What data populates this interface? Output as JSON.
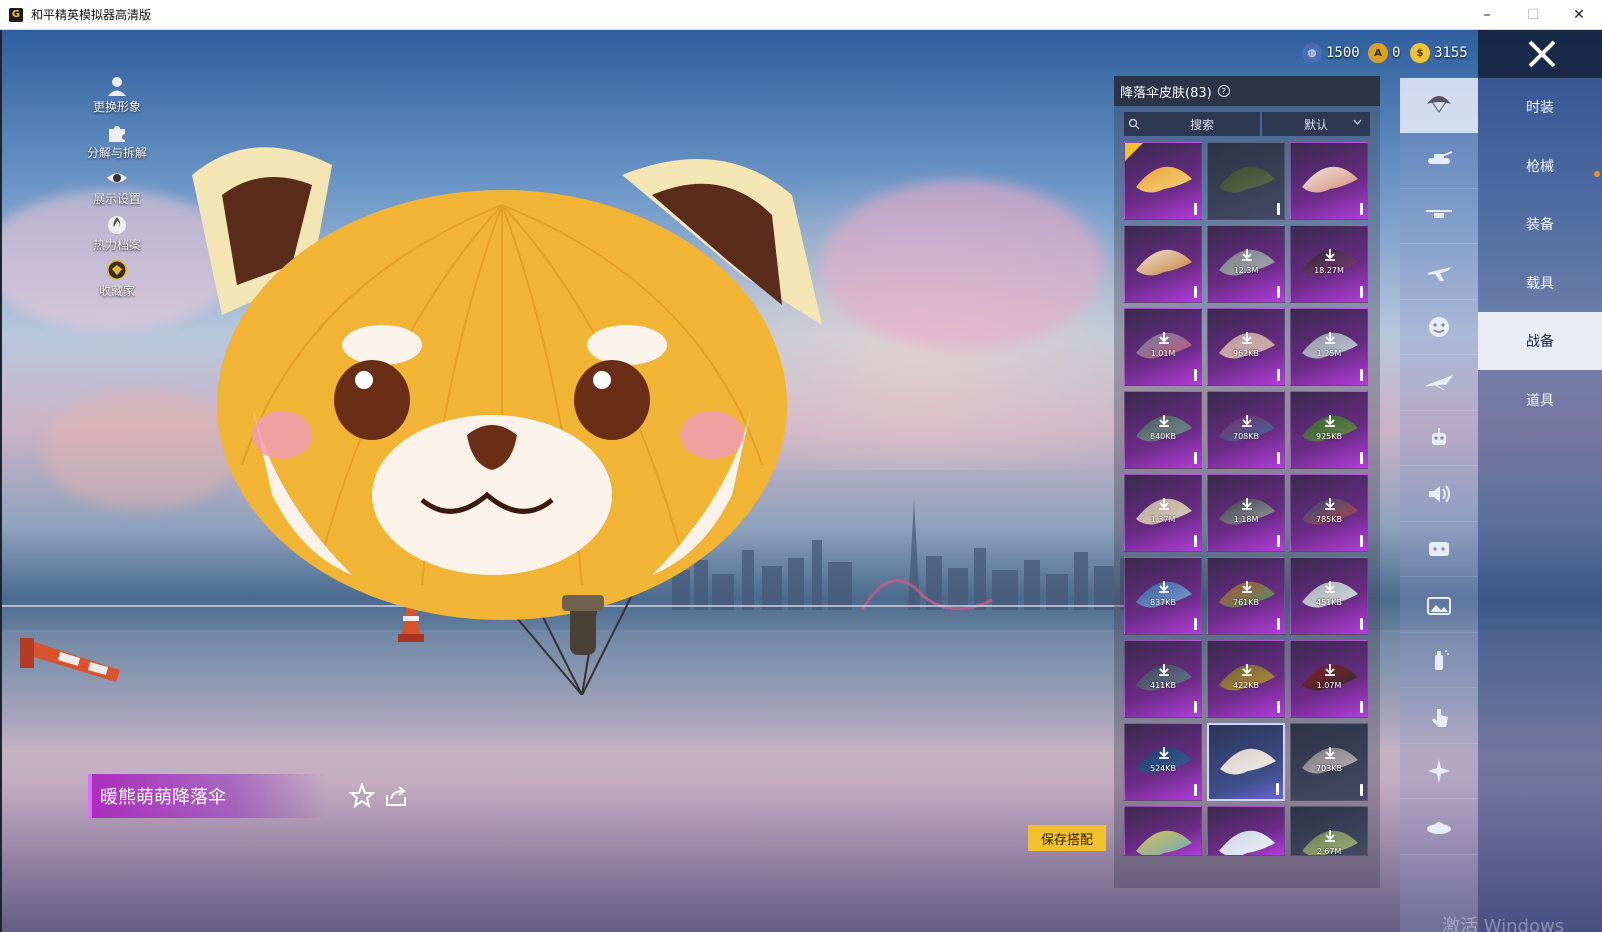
{
  "window": {
    "title": "和平精英模拟器高清版",
    "app_icon_letter": "G",
    "controls": {
      "minimize": "–",
      "maximize": "☐",
      "close": "✕"
    }
  },
  "quick_menu": [
    {
      "label": "更换形象",
      "icon": "person-icon"
    },
    {
      "label": "分解与拆解",
      "icon": "puzzle-icon"
    },
    {
      "label": "展示设置",
      "icon": "eye-icon"
    },
    {
      "label": "热力档案",
      "icon": "flame-icon"
    },
    {
      "label": "收藏家",
      "icon": "collector-badge-icon"
    }
  ],
  "currency": [
    {
      "icon": "globe-coin-icon",
      "amount": "1500",
      "color": "#4a6fb8"
    },
    {
      "icon": "a-coin-icon",
      "amount": "0",
      "color": "#d8a12c"
    },
    {
      "icon": "gold-coin-icon",
      "amount": "3155",
      "color": "#f0c23a"
    }
  ],
  "item_name": "暖熊萌萌降落伞",
  "save_button": "保存搭配",
  "panel": {
    "title": "降落伞皮肤(83)",
    "search_placeholder": "搜索",
    "sort_label": "默认"
  },
  "skins": [
    {
      "style": "purple",
      "size": "",
      "selected": false,
      "tag": true,
      "colors": [
        "#e9a33a",
        "#f5d27c"
      ]
    },
    {
      "style": "dark",
      "size": "",
      "selected": false,
      "tag": false,
      "colors": [
        "#3e4a34",
        "#5b6a49"
      ]
    },
    {
      "style": "purple",
      "size": "",
      "selected": false,
      "tag": false,
      "colors": [
        "#f1e7e0",
        "#d28b74"
      ]
    },
    {
      "style": "purple",
      "size": "",
      "selected": false,
      "tag": false,
      "colors": [
        "#efe1d2",
        "#c6813e"
      ]
    },
    {
      "style": "purple",
      "size": "12.3M",
      "selected": false,
      "tag": false,
      "colors": [
        "#7a7d86",
        "#a6a9b0"
      ]
    },
    {
      "style": "purple",
      "size": "18.27M",
      "selected": false,
      "tag": false,
      "colors": [
        "#2a2a33",
        "#8b3b7b"
      ]
    },
    {
      "style": "purple",
      "size": "1.01M",
      "selected": false,
      "tag": false,
      "colors": [
        "#6f7fa6",
        "#c75a7a"
      ]
    },
    {
      "style": "purple",
      "size": "962KB",
      "selected": false,
      "tag": false,
      "colors": [
        "#b49a9a",
        "#d9b0b0"
      ]
    },
    {
      "style": "purple",
      "size": "1.25M",
      "selected": false,
      "tag": false,
      "colors": [
        "#8e93a6",
        "#c2c6d4"
      ]
    },
    {
      "style": "purple",
      "size": "840KB",
      "selected": false,
      "tag": false,
      "colors": [
        "#4b5b63",
        "#7c8c92"
      ]
    },
    {
      "style": "purple",
      "size": "708KB",
      "selected": false,
      "tag": false,
      "colors": [
        "#7a2e6b",
        "#3e6a9b"
      ]
    },
    {
      "style": "purple",
      "size": "925KB",
      "selected": false,
      "tag": false,
      "colors": [
        "#375c3b",
        "#6c8a46"
      ]
    },
    {
      "style": "purple",
      "size": "1.37M",
      "selected": false,
      "tag": false,
      "colors": [
        "#b7a596",
        "#dccfc2"
      ]
    },
    {
      "style": "purple",
      "size": "1.18M",
      "selected": false,
      "tag": false,
      "colors": [
        "#3b3f44",
        "#9a9ea6"
      ]
    },
    {
      "style": "purple",
      "size": "785KB",
      "selected": false,
      "tag": false,
      "colors": [
        "#2f4d86",
        "#b4473d"
      ]
    },
    {
      "style": "purple",
      "size": "837KB",
      "selected": false,
      "tag": false,
      "colors": [
        "#395a9a",
        "#7fa2d6"
      ]
    },
    {
      "style": "purple",
      "size": "761KB",
      "selected": false,
      "tag": false,
      "colors": [
        "#b04a34",
        "#4f9a6c"
      ]
    },
    {
      "style": "purple",
      "size": "451KB",
      "selected": false,
      "tag": false,
      "colors": [
        "#a5aab7",
        "#d6d9e0"
      ]
    },
    {
      "style": "purple",
      "size": "411KB",
      "selected": false,
      "tag": false,
      "colors": [
        "#3c4556",
        "#6d7891"
      ]
    },
    {
      "style": "purple",
      "size": "422KB",
      "selected": false,
      "tag": false,
      "colors": [
        "#6b6233",
        "#b88c3d"
      ]
    },
    {
      "style": "purple",
      "size": "1.07M",
      "selected": false,
      "tag": false,
      "colors": [
        "#8a1e26",
        "#2e2e36"
      ]
    },
    {
      "style": "purple",
      "size": "524KB",
      "selected": false,
      "tag": false,
      "colors": [
        "#1f3b6a",
        "#3c5e9a"
      ]
    },
    {
      "style": "blue",
      "size": "",
      "selected": true,
      "tag": false,
      "colors": [
        "#d7cfc9",
        "#f1ece8"
      ]
    },
    {
      "style": "dark",
      "size": "703KB",
      "selected": false,
      "tag": false,
      "colors": [
        "#7e7780",
        "#b5b0b5"
      ]
    },
    {
      "style": "purple",
      "size": "",
      "selected": false,
      "tag": false,
      "colors": [
        "#d5c44d",
        "#73a5c7"
      ]
    },
    {
      "style": "purple",
      "size": "",
      "selected": false,
      "tag": false,
      "colors": [
        "#c7d4e4",
        "#eef2f8"
      ]
    },
    {
      "style": "dark",
      "size": "2.67M",
      "selected": false,
      "tag": false,
      "colors": [
        "#6d7e55",
        "#a5b07a"
      ]
    }
  ],
  "category_icons": [
    "parachute-icon",
    "tank-icon",
    "drone-icon",
    "plane-icon",
    "face-icon",
    "glider-icon",
    "robot-icon",
    "speaker-icon",
    "chat-bubble-icon",
    "photo-icon",
    "spray-icon",
    "tap-icon",
    "sparkle-icon",
    "ufo-icon"
  ],
  "tabs": [
    {
      "label": "时装",
      "active": false,
      "dot": false
    },
    {
      "label": "枪械",
      "active": false,
      "dot": true
    },
    {
      "label": "装备",
      "active": false,
      "dot": false
    },
    {
      "label": "载具",
      "active": false,
      "dot": false
    },
    {
      "label": "战备",
      "active": true,
      "dot": false
    },
    {
      "label": "道具",
      "active": false,
      "dot": false
    }
  ],
  "watermark": "激活 Windows"
}
